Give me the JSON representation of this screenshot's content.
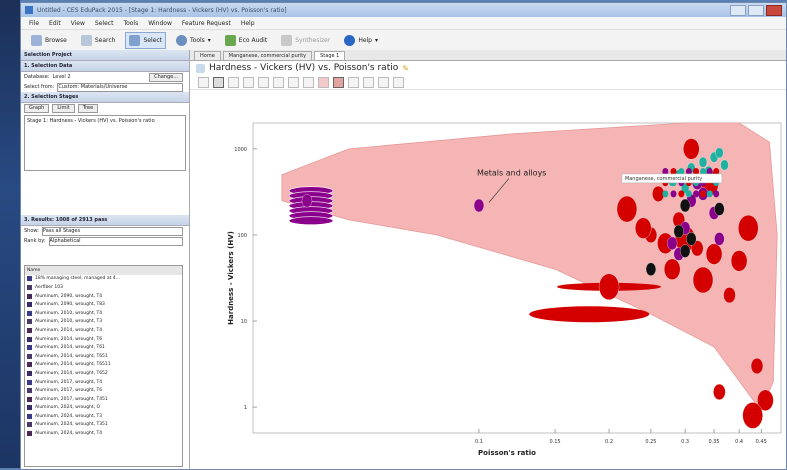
{
  "window": {
    "title": "Untitled - CES EduPack 2015 - [Stage 1: Hardness - Vickers (HV) vs. Poisson's ratio]"
  },
  "menu": [
    "File",
    "Edit",
    "View",
    "Select",
    "Tools",
    "Window",
    "Feature Request",
    "Help"
  ],
  "toolbar": {
    "browse": "Browse",
    "search": "Search",
    "select": "Select",
    "tools": "Tools",
    "eco": "Eco Audit",
    "synth": "Synthesizer",
    "help": "Help"
  },
  "left": {
    "project_header": "Selection Project",
    "data_header": "1. Selection Data",
    "database_label": "Database:",
    "database_value": "Level 2",
    "change_button": "Change...",
    "filter_label": "Select from:",
    "filter_value": "Custom: Materials/Universe",
    "stages_header": "2. Selection Stages",
    "stage_buttons": [
      "Graph",
      "Limit",
      "Tree"
    ],
    "stage_item": "Stage 1: Hardness - Vickers (HV) vs. Poisson's ratio",
    "results_header": "3. Results: 1008 of 2913 pass",
    "show_label": "Show:",
    "show_value": "Pass all Stages",
    "rank_label": "Rank by:",
    "rank_value": "Alphabetical",
    "name_header": "Name",
    "results": [
      "18% managing steel, managed at 4...",
      "Aerfiber 103",
      "Aluminum, 2090, wrought, T4",
      "Aluminum, 2090, wrought, T83",
      "Aluminum, 2010, wrought, T4",
      "Aluminum, 2010, wrought, T3",
      "Aluminum, 2014, wrought, T4",
      "Aluminum, 2014, wrought, T6",
      "Aluminum, 2014, wrought, T61",
      "Aluminum, 2014, wrought, T651",
      "Aluminum, 2014, wrought, T6511",
      "Aluminum, 2014, wrought, T652",
      "Aluminum, 2017, wrought, T4",
      "Aluminum, 2017, wrought, T6",
      "Aluminum, 2017, wrought, T451",
      "Aluminum, 2024, wrought, O",
      "Aluminum, 2024, wrought, T3",
      "Aluminum, 2024, wrought, T351",
      "Aluminum, 2024, wrought, T4"
    ]
  },
  "tabs": [
    "Home",
    "Manganese, commercial purity",
    "Stage 1"
  ],
  "chart": {
    "title": "Hardness - Vickers (HV) vs. Poisson's ratio",
    "annotation": "Metals and alloys",
    "tooltip": "Manganese, commercial purity",
    "status": "1008 of 2913 pass"
  },
  "chart_data": {
    "type": "scatter",
    "title": "Hardness - Vickers (HV) vs. Poisson's ratio",
    "xlabel": "Poisson's ratio",
    "ylabel": "Hardness - Vickers (HV)",
    "x_scale": "log",
    "y_scale": "log",
    "xlim": [
      0.03,
      0.5
    ],
    "ylim": [
      0.5,
      2000
    ],
    "x_ticks": [
      0.1,
      0.15,
      0.2,
      0.25,
      0.3,
      0.35,
      0.4,
      0.45
    ],
    "y_ticks": [
      1,
      10,
      100,
      1000
    ],
    "y_tick_labels": [
      "1",
      "10",
      "100",
      "1000"
    ],
    "envelope": {
      "name": "Metals and alloys",
      "color": "#f6b5b5"
    },
    "series": [
      {
        "color": "#d40000",
        "points": [
          [
            0.25,
            100
          ],
          [
            0.27,
            80
          ],
          [
            0.3,
            90
          ],
          [
            0.32,
            70
          ],
          [
            0.35,
            60
          ],
          [
            0.33,
            30
          ],
          [
            0.38,
            20
          ],
          [
            0.4,
            50
          ],
          [
            0.42,
            120
          ],
          [
            0.44,
            3
          ],
          [
            0.46,
            1.2
          ],
          [
            0.43,
            0.8
          ],
          [
            0.36,
            1.5
          ],
          [
            0.28,
            40
          ],
          [
            0.22,
            200
          ],
          [
            0.26,
            300
          ],
          [
            0.31,
            1000
          ],
          [
            0.34,
            400
          ],
          [
            0.29,
            150
          ],
          [
            0.24,
            120
          ],
          [
            0.2,
            25
          ]
        ]
      },
      {
        "color": "#8b008b",
        "points": [
          [
            0.04,
            250
          ],
          [
            0.1,
            220
          ],
          [
            0.28,
            80
          ],
          [
            0.3,
            120
          ],
          [
            0.33,
            300
          ],
          [
            0.35,
            180
          ],
          [
            0.36,
            90
          ],
          [
            0.32,
            400
          ],
          [
            0.31,
            250
          ],
          [
            0.29,
            60
          ]
        ]
      },
      {
        "color": "#20b0a0",
        "points": [
          [
            0.29,
            500
          ],
          [
            0.31,
            600
          ],
          [
            0.33,
            700
          ],
          [
            0.35,
            800
          ],
          [
            0.3,
            350
          ],
          [
            0.32,
            450
          ],
          [
            0.34,
            550
          ],
          [
            0.36,
            900
          ],
          [
            0.37,
            650
          ],
          [
            0.28,
            420
          ]
        ]
      },
      {
        "color": "#111111",
        "points": [
          [
            0.29,
            110
          ],
          [
            0.3,
            65
          ],
          [
            0.31,
            90
          ],
          [
            0.36,
            200
          ],
          [
            0.25,
            40
          ],
          [
            0.3,
            220
          ]
        ]
      }
    ]
  }
}
